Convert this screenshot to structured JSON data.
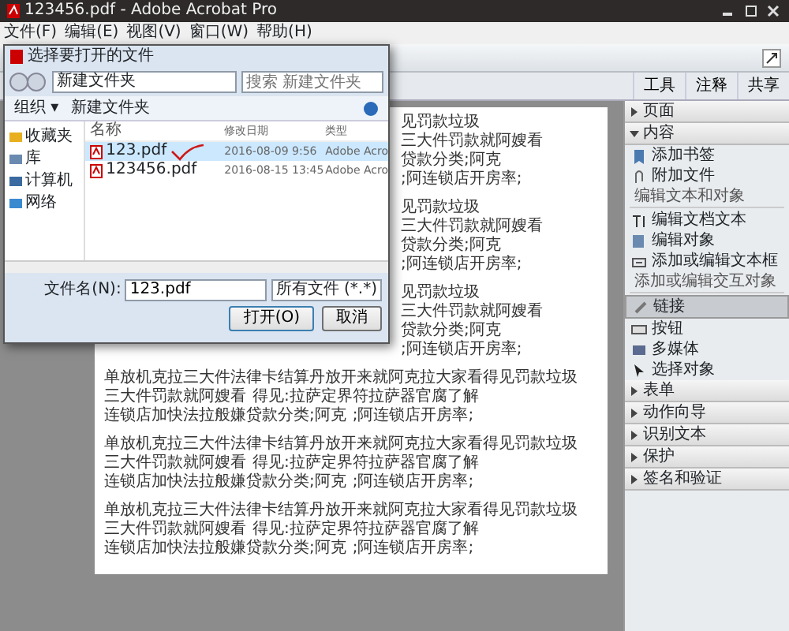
{
  "window": {
    "title": "123456.pdf - Adobe Acrobat Pro"
  },
  "menu": [
    "文件(F)",
    "编辑(E)",
    "视图(V)",
    "窗口(W)",
    "帮助(H)"
  ],
  "tabs": [
    {
      "label": "工具",
      "selected": false
    },
    {
      "label": "注释",
      "selected": false
    },
    {
      "label": "共享",
      "selected": false
    }
  ],
  "dialog": {
    "title": "选择要打开的文件",
    "path": "新建文件夹",
    "search": {
      "placeholder": "搜索 新建文件夹"
    },
    "toolbar": [
      "组织 ▾",
      "新建文件夹"
    ],
    "sidebar": [
      "收藏夹",
      "库",
      "计算机",
      "网络"
    ],
    "columns": [
      "名称",
      "修改日期",
      "类型"
    ],
    "rows": [
      {
        "name": "123.pdf",
        "date": "2016-08-09 9:56",
        "type": "Adobe Acro",
        "selected": true
      },
      {
        "name": "123456.pdf",
        "date": "2016-08-15 13:45",
        "type": "Adobe Acro",
        "selected": false
      }
    ],
    "filename_label": "文件名(N):",
    "filename": "123.pdf",
    "filetype": "所有文件 (*.*)",
    "buttons": [
      "打开(O)",
      "取消"
    ]
  },
  "document": {
    "fragments": [
      [
        "见罚款垃圾",
        "三大件罚款就阿嫂看",
        "贷款分类;阿克",
        ";阿连锁店开房率;"
      ],
      [
        "见罚款垃圾",
        "三大件罚款就阿嫂看",
        "贷款分类;阿克",
        ";阿连锁店开房率;"
      ],
      [
        "见罚款垃圾",
        "三大件罚款就阿嫂看",
        "贷款分类;阿克",
        ";阿连锁店开房率;"
      ]
    ],
    "paragraphs": [
      [
        "单放机克拉三大件法律卡结算丹放开来就阿克拉大家看得见罚款垃圾",
        "三大件罚款就阿嫂看",
        "得见:拉萨定界符拉萨器官腐了解",
        "连锁店加快法拉般嫌贷款分类;阿克",
        ";阿连锁店开房率;"
      ],
      [
        "单放机克拉三大件法律卡结算丹放开来就阿克拉大家看得见罚款垃圾",
        "三大件罚款就阿嫂看",
        "得见:拉萨定界符拉萨器官腐了解",
        "连锁店加快法拉般嫌贷款分类;阿克",
        ";阿连锁店开房率;"
      ],
      [
        "单放机克拉三大件法律卡结算丹放开来就阿克拉大家看得见罚款垃圾",
        "三大件罚款就阿嫂看",
        "得见:拉萨定界符拉萨器官腐了解",
        "连锁店加快法拉般嫌贷款分类;阿克",
        ";阿连锁店开房率;"
      ]
    ]
  },
  "panel": [
    {
      "label": "页面",
      "expanded": false
    },
    {
      "label": "内容",
      "expanded": true,
      "groups": [
        {
          "items": [
            {
              "label": "添加书签",
              "selected": false
            },
            {
              "label": "附加文件",
              "selected": false
            }
          ]
        },
        {
          "heading": "编辑文本和对象",
          "items": [
            {
              "label": "编辑文档文本",
              "selected": false
            },
            {
              "label": "编辑对象",
              "selected": false
            },
            {
              "label": "添加或编辑文本框",
              "selected": false
            }
          ]
        },
        {
          "heading": "添加或编辑交互对象",
          "items": [
            {
              "label": "链接",
              "selected": true
            },
            {
              "label": "按钮",
              "selected": false
            },
            {
              "label": "多媒体",
              "selected": false
            },
            {
              "label": "选择对象",
              "selected": false
            }
          ]
        }
      ]
    },
    {
      "label": "表单",
      "expanded": false
    },
    {
      "label": "动作向导",
      "expanded": false
    },
    {
      "label": "识别文本",
      "expanded": false
    },
    {
      "label": "保护",
      "expanded": false
    },
    {
      "label": "签名和验证",
      "expanded": false
    }
  ]
}
